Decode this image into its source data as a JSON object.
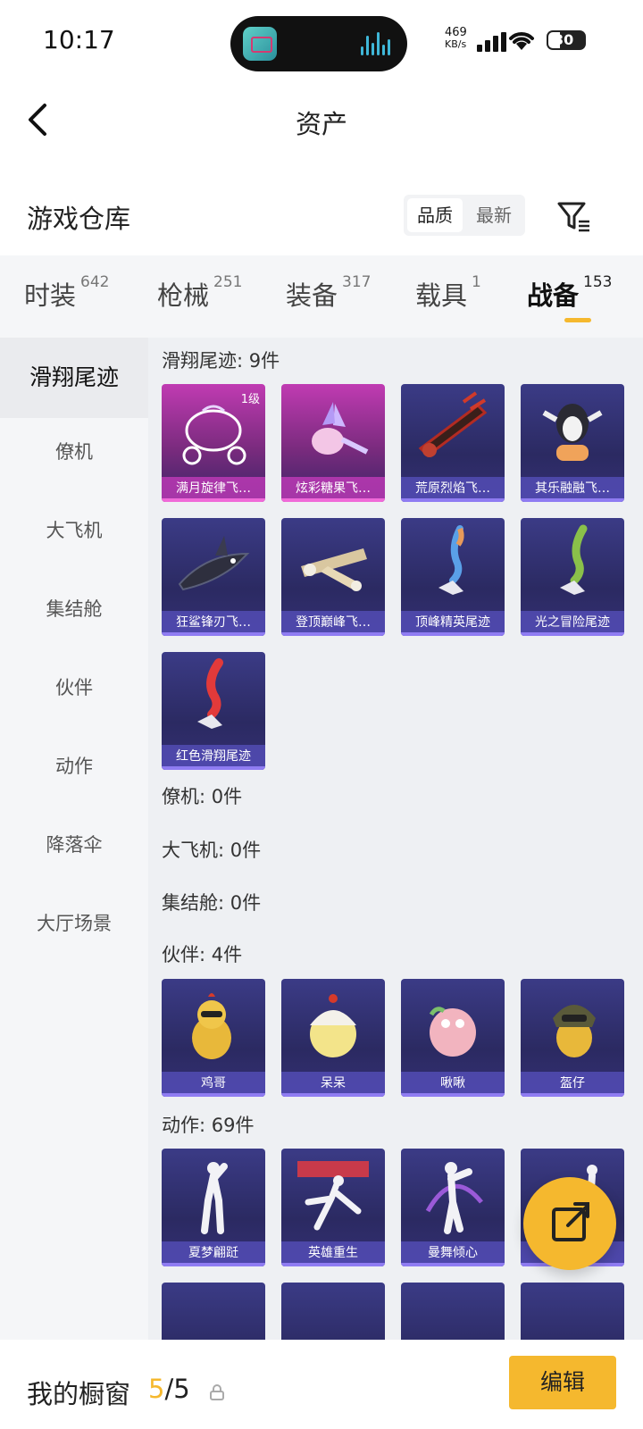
{
  "status_bar": {
    "time": "10:17",
    "net_speed_value": "469",
    "net_speed_unit": "KB/s",
    "battery": "30"
  },
  "header": {
    "title": "资产"
  },
  "warehouse": {
    "title": "游戏仓库",
    "sort_options": [
      "品质",
      "最新"
    ],
    "selected_sort": "品质"
  },
  "tabs": [
    {
      "label": "时装",
      "count": "642"
    },
    {
      "label": "枪械",
      "count": "251"
    },
    {
      "label": "装备",
      "count": "317"
    },
    {
      "label": "载具",
      "count": "1"
    },
    {
      "label": "战备",
      "count": "153"
    }
  ],
  "active_tab": "战备",
  "sidebar": {
    "items": [
      "滑翔尾迹",
      "僚机",
      "大飞机",
      "集结舱",
      "伙伴",
      "动作",
      "降落伞",
      "大厅场景"
    ],
    "active": "滑翔尾迹"
  },
  "sections": {
    "glide": {
      "title": "滑翔尾迹: 9件",
      "items": [
        "满月旋律飞…",
        "炫彩糖果飞…",
        "荒原烈焰飞…",
        "其乐融融飞…",
        "狂鲨锋刃飞…",
        "登顶巅峰飞…",
        "顶峰精英尾迹",
        "光之冒险尾迹",
        "红色滑翔尾迹"
      ],
      "first_level": "1级"
    },
    "wingman": {
      "title": "僚机: 0件"
    },
    "plane": {
      "title": "大飞机: 0件"
    },
    "pod": {
      "title": "集结舱: 0件"
    },
    "partner": {
      "title": "伙伴: 4件",
      "items": [
        "鸡哥",
        "呆呆",
        "啾啾",
        "盔仔"
      ]
    },
    "emote": {
      "title": "动作: 69件",
      "items": [
        "夏梦翩跹",
        "英雄重生",
        "曼舞倾心",
        ""
      ]
    }
  },
  "bottom_bar": {
    "window_label": "我的橱窗",
    "count_current": "5",
    "count_total": "/5",
    "edit_label": "编辑"
  },
  "colors": {
    "accent": "#f5b82e",
    "card_blue": "#2b2a62",
    "card_pink": "#c03bb2"
  }
}
